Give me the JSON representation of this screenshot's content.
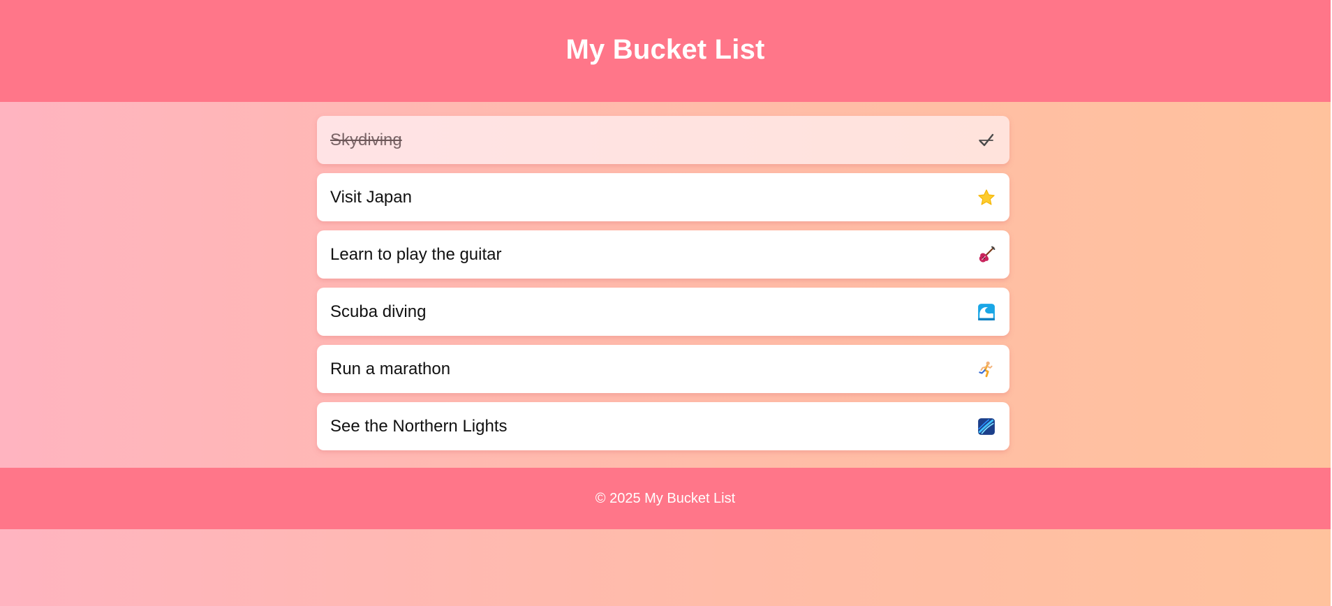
{
  "header": {
    "title": "My Bucket List"
  },
  "items": [
    {
      "label": "Skydiving",
      "completed": true,
      "icon": "check-mark-icon"
    },
    {
      "label": "Visit Japan",
      "completed": false,
      "icon": "star-icon"
    },
    {
      "label": "Learn to play the guitar",
      "completed": false,
      "icon": "guitar-icon"
    },
    {
      "label": "Scuba diving",
      "completed": false,
      "icon": "wave-icon"
    },
    {
      "label": "Run a marathon",
      "completed": false,
      "icon": "runner-icon"
    },
    {
      "label": "See the Northern Lights",
      "completed": false,
      "icon": "aurora-icon"
    }
  ],
  "footer": {
    "text": "© 2025 My Bucket List"
  },
  "colors": {
    "header_bg": "#ff7689",
    "footer_bg": "#ff7689",
    "gradient_start": "#ffb4c0",
    "gradient_end": "#ffc29d",
    "card_bg": "#ffffff",
    "completed_card_bg": "#ffe3e5",
    "star": "#fdcb2e",
    "guitar": "#c8235b",
    "wave": "#1aa6e6",
    "runner": "#f5a623",
    "aurora": "#1c3f8a"
  }
}
